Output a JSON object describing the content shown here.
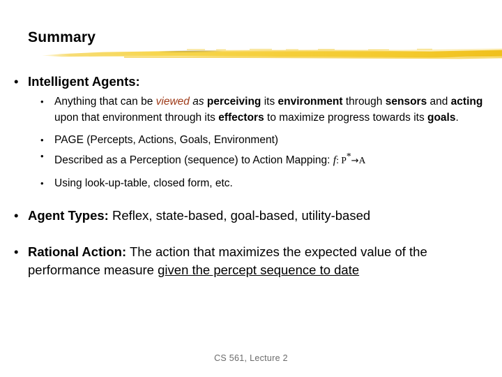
{
  "slide": {
    "title": "Summary",
    "accent_color": "#F5D03C",
    "text_color": "#000000",
    "highlight_color": "#9E3A18",
    "footer": "CS 561, Lecture 2",
    "bullets": {
      "intelligent_agents": {
        "marker": "•",
        "heading": "Intelligent Agents:",
        "sub": {
          "anything": {
            "marker": "•",
            "t1": "Anything that can be ",
            "t2_red_italic": "viewed",
            "t3_italic": " as ",
            "t4_bold": "perceiving",
            "t5": " its ",
            "t6_bold": "environment",
            "t7": " through ",
            "t8_bold": "sensors",
            "t9": " and ",
            "t10_bold": "acting",
            "t11": " upon that environment through its ",
            "t12_bold": "effectors",
            "t13": " to maximize progress towards its ",
            "t14_bold": "goals",
            "t15": "."
          },
          "page": {
            "marker": "•",
            "text": "PAGE (Percepts, Actions, Goals, Environment)"
          },
          "described": {
            "marker": "•",
            "text": "Described as a Perception (sequence) to Action Mapping: ",
            "math_f": "f",
            "math_colon": ": ",
            "math_domain": "P",
            "math_star": "*",
            "math_arrow": "→",
            "math_codomain": "A"
          },
          "lookup": {
            "marker": "•",
            "text": "Using look-up-table, closed form, etc."
          }
        }
      },
      "agent_types": {
        "marker": "•",
        "heading": "Agent Types:",
        "text": " Reflex, state-based, goal-based, utility-based"
      },
      "rational_action": {
        "marker": "•",
        "heading": "Rational Action:",
        "t1": " The action that maximizes the expected value of the performance measure ",
        "t2_underline": "given the percept sequence to date"
      }
    }
  }
}
